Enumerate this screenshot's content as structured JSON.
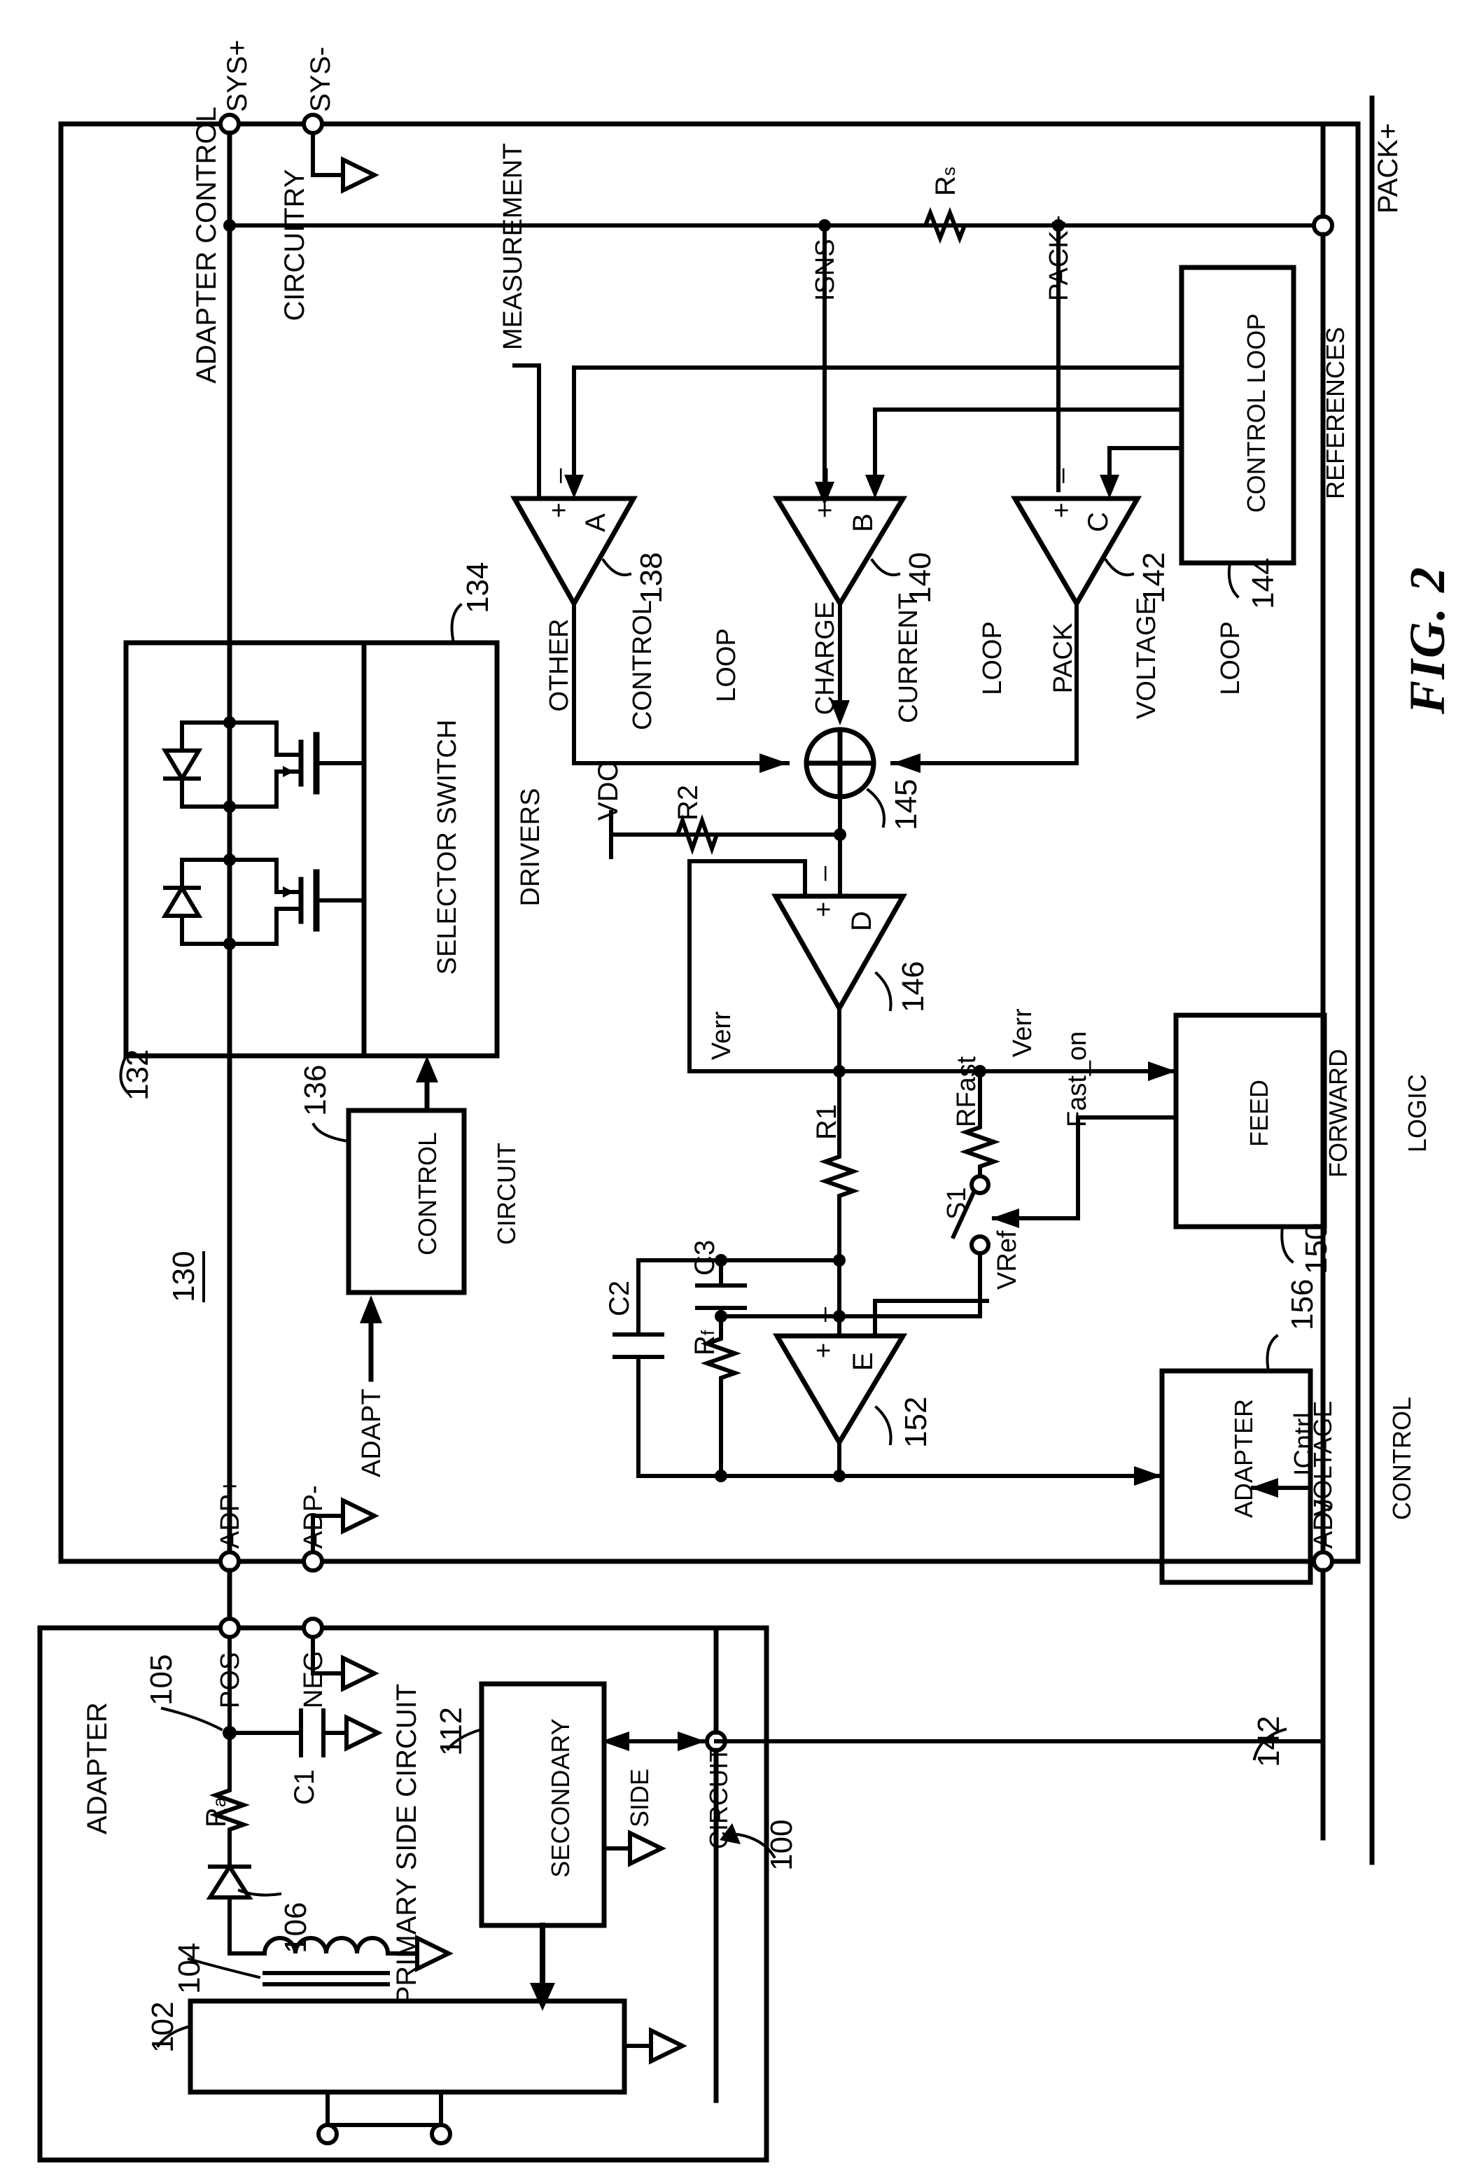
{
  "figure": {
    "caption": "FIG. 2",
    "system_ref": "100"
  },
  "terminals": {
    "sys_plus": "SYS+",
    "sys_minus": "SYS-",
    "pack_plus_right": "PACK+",
    "pack_plus_node": "PACK+",
    "adp_plus": "ADP+",
    "adp_minus": "ADP-",
    "pos": "POS",
    "neg": "NEG",
    "adj": "ADJ"
  },
  "adapter_control": {
    "title_line1": "ADAPTER CONTROL",
    "title_line2": "CIRCUITRY",
    "ref": "130",
    "selector_switch_ref": "132",
    "selector_switch_drivers": {
      "line1": "SELECTOR SWITCH",
      "line2": "DRIVERS",
      "ref": "134"
    },
    "control_circuit": {
      "line1": "CONTROL",
      "line2": "CIRCUIT",
      "ref": "136",
      "input_signal": "ADAPT"
    }
  },
  "loops": {
    "other_control_loop": {
      "name_line1": "OTHER",
      "name_line2": "CONTROL",
      "name_line3": "LOOP",
      "amp_letter": "A",
      "ref": "138",
      "plus": "+",
      "minus": "–",
      "input_label": "MEASUREMENT"
    },
    "charge_current_loop": {
      "name_line1": "CHARGE",
      "name_line2": "CURRENT",
      "name_line3": "LOOP",
      "amp_letter": "B",
      "ref": "140",
      "plus": "+",
      "minus": "–",
      "input_label": "ISNS"
    },
    "pack_voltage_loop": {
      "name_line1": "PACK",
      "name_line2": "VOLTAGE",
      "name_line3": "LOOP",
      "amp_letter": "C",
      "ref": "142",
      "plus": "+",
      "minus": "–",
      "input_label": "PACK+"
    }
  },
  "control_loop_references": {
    "line1": "CONTROL LOOP",
    "line2": "REFERENCES",
    "ref": "144"
  },
  "summing_node": {
    "ref": "145",
    "symbol": "+"
  },
  "amp_d": {
    "letter": "D",
    "ref": "146",
    "plus": "+",
    "minus": "–",
    "feedback_label": "Verr",
    "output_label": "Verr"
  },
  "amp_e": {
    "letter": "E",
    "ref": "152",
    "plus": "+",
    "minus": "–",
    "ref_input": "VRef"
  },
  "feed_forward_logic": {
    "line1": "FEED",
    "line2": "FORWARD",
    "line3": "LOGIC",
    "ref": "150",
    "input_verr": "Verr",
    "output_fast_on": "Fast_on"
  },
  "adapter_voltage_control": {
    "line1": "ADAPTER",
    "line2": "VOLTAGE",
    "line3": "CONTROL",
    "ref": "156",
    "current_label": "ICntrl"
  },
  "components": {
    "rs": "R",
    "rs_sub": "s",
    "r1": "R1",
    "r2": "R2",
    "rf": "R",
    "rf_sub": "f",
    "rfast": "RFast",
    "c1": "C1",
    "c2": "C2",
    "c3": "C3",
    "ra": "R",
    "ra_sub": "a",
    "s1": "S1",
    "vdc": "VDC",
    "vref": "VRef",
    "verr": "Verr"
  },
  "adapter": {
    "title": "ADAPTER",
    "primary_side_circuit": "PRIMARY SIDE CIRCUIT",
    "primary_ref": "102",
    "secondary_side_circuit_line1": "SECONDARY",
    "secondary_side_circuit_line2": "SIDE",
    "secondary_side_circuit_line3": "CIRCUIT",
    "secondary_ref": "112",
    "transformer_ref": "104",
    "diode_ref": "106",
    "node_ref": "105",
    "feedback_ref": "142"
  }
}
